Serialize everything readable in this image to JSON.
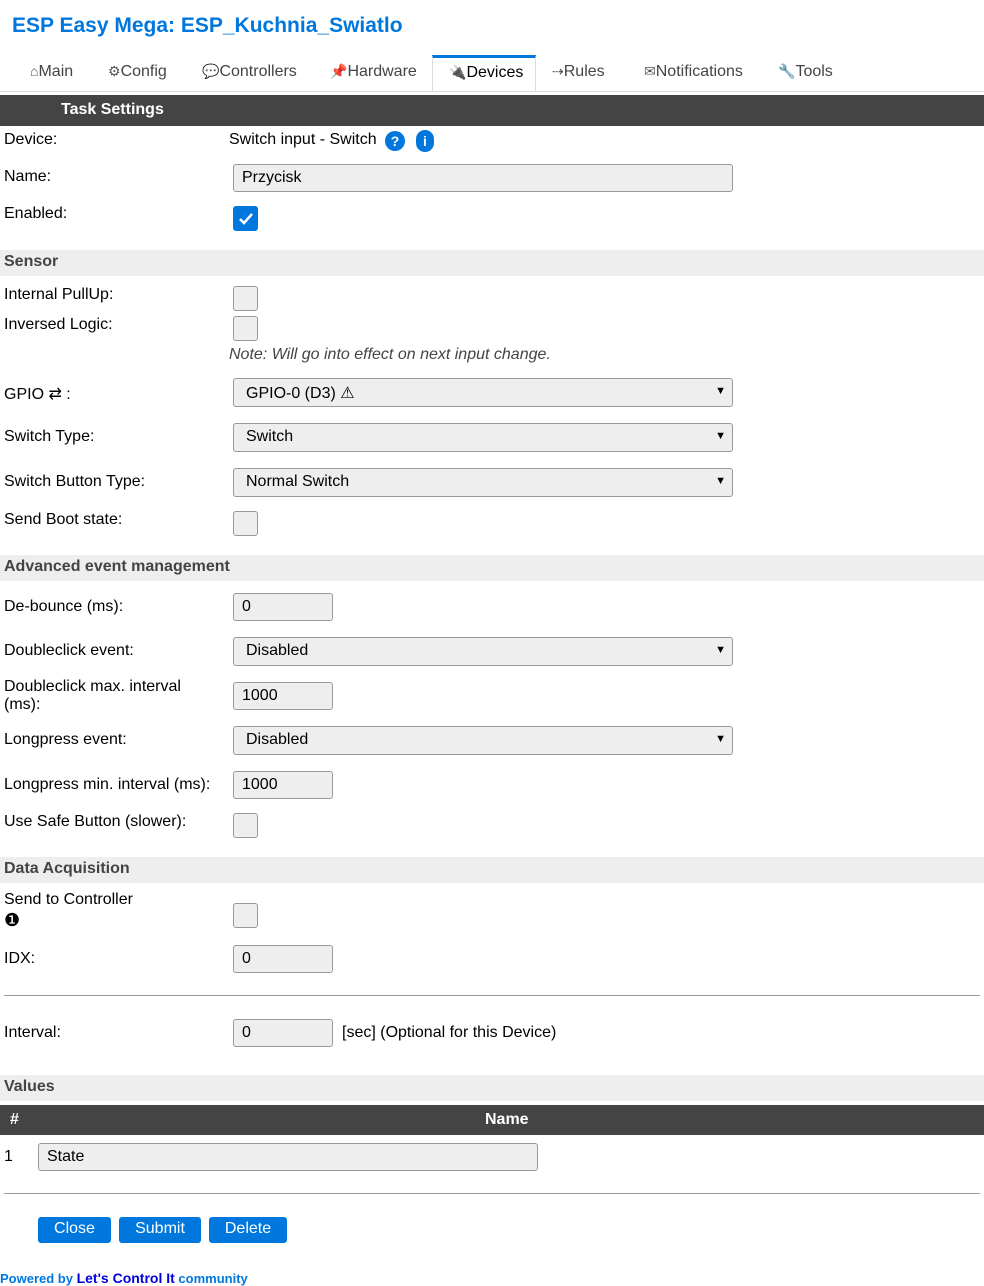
{
  "header": {
    "title": "ESP Easy Mega: ESP_Kuchnia_Swiatlo"
  },
  "tabs": [
    {
      "icon": "⌂",
      "label": "Main"
    },
    {
      "icon": "⚙",
      "label": "Config"
    },
    {
      "icon": "💬",
      "label": "Controllers"
    },
    {
      "icon": "📌",
      "label": "Hardware"
    },
    {
      "icon": "🔌",
      "label": "Devices"
    },
    {
      "icon": "⇢",
      "label": "Rules"
    },
    {
      "icon": "✉",
      "label": "Notifications"
    },
    {
      "icon": "🔧",
      "label": "Tools"
    }
  ],
  "task": {
    "header": "Task Settings",
    "device_label": "Device:",
    "device_value": "Switch input - Switch",
    "help_glyph": "?",
    "info_glyph": "i",
    "name_label": "Name:",
    "name_value": "Przycisk",
    "enabled_label": "Enabled:",
    "enabled": true
  },
  "sensor": {
    "header": "Sensor",
    "pullup_label": "Internal PullUp:",
    "pullup": false,
    "inversed_label": "Inversed Logic:",
    "inversed": false,
    "note": "Note: Will go into effect on next input change.",
    "gpio_label": "GPIO ⇄ :",
    "gpio_value": "GPIO-0 (D3) ⚠",
    "switch_type_label": "Switch Type:",
    "switch_type_value": "Switch",
    "button_type_label": "Switch Button Type:",
    "button_type_value": "Normal Switch",
    "boot_state_label": "Send Boot state:",
    "boot_state": false
  },
  "advanced": {
    "header": "Advanced event management",
    "debounce_label": "De-bounce (ms):",
    "debounce_value": "0",
    "doubleclick_label": "Doubleclick event:",
    "doubleclick_value": "Disabled",
    "dc_interval_label_1": "Doubleclick max. interval",
    "dc_interval_label_2": "(ms):",
    "dc_interval_value": "1000",
    "longpress_label": "Longpress event:",
    "longpress_value": "Disabled",
    "lp_interval_label": "Longpress min. interval (ms):",
    "lp_interval_value": "1000",
    "safe_button_label": "Use Safe Button (slower):",
    "safe_button": false
  },
  "acquisition": {
    "header": "Data Acquisition",
    "send_label": "Send to Controller",
    "controller_number": "❶",
    "send": false,
    "idx_label": "IDX:",
    "idx_value": "0",
    "interval_label": "Interval:",
    "interval_value": "0",
    "interval_suffix": "[sec] (Optional for this Device)"
  },
  "values": {
    "header": "Values",
    "col_num": "#",
    "col_name": "Name",
    "rows": [
      {
        "num": "1",
        "name": "State"
      }
    ]
  },
  "buttons": {
    "close": "Close",
    "submit": "Submit",
    "delete": "Delete"
  },
  "footer": {
    "powered": "Powered by ",
    "brand": "Let's Control It",
    "community": " community"
  },
  "colors": {
    "accent": "#0077dd",
    "dark_header": "#444444",
    "section_bg": "#eeeeee"
  }
}
